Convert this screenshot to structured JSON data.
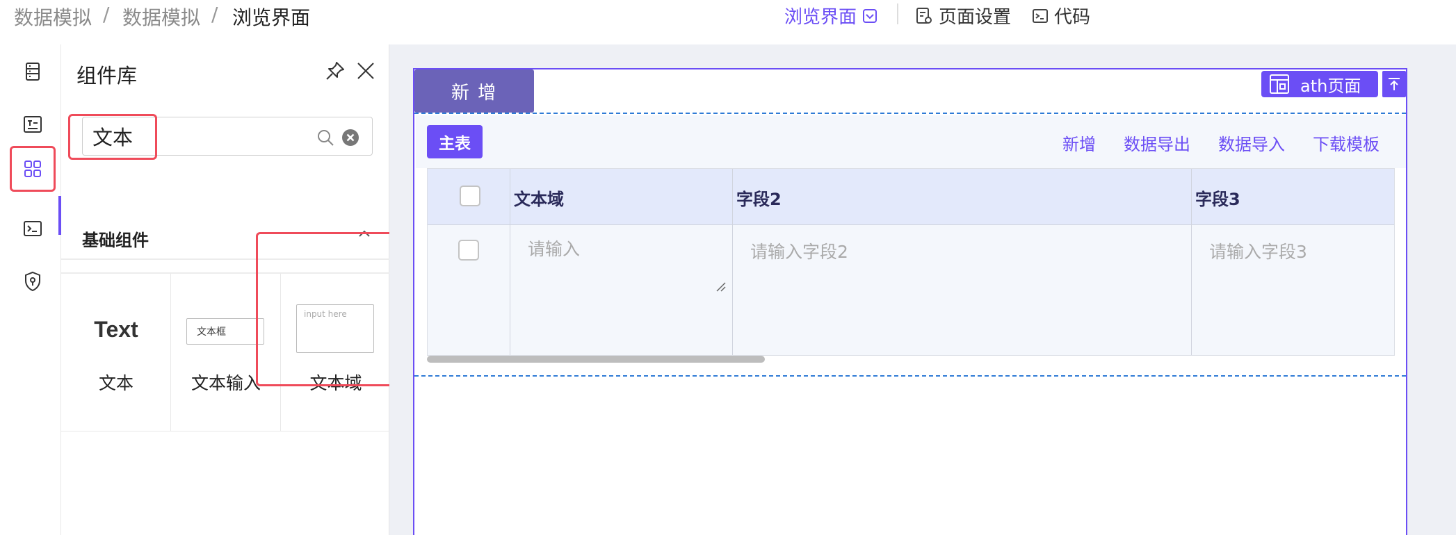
{
  "breadcrumb": {
    "items": [
      "数据模拟",
      "数据模拟",
      "浏览界面"
    ],
    "separator": "/"
  },
  "topmenu": {
    "browse": "浏览界面",
    "page_settings": "页面设置",
    "code": "代码"
  },
  "rail": {
    "icons": [
      "list-icon",
      "form-icon",
      "components-icon",
      "terminal-icon",
      "security-icon"
    ],
    "active_index": 2
  },
  "panel": {
    "title": "组件库",
    "search": {
      "value": "文本",
      "placeholder": ""
    },
    "group": {
      "title": "基础组件",
      "expanded": true
    },
    "components": [
      {
        "preview": "Text",
        "label": "文本"
      },
      {
        "preview": "文本框",
        "label": "文本输入"
      },
      {
        "preview": "input here",
        "label": "文本域"
      }
    ]
  },
  "canvas": {
    "add_button": "新 增",
    "page_tag": "ath页面",
    "tab": "主表",
    "actions": [
      "新增",
      "数据导出",
      "数据导入",
      "下载模板"
    ],
    "table": {
      "headers": [
        "文本域",
        "字段2",
        "字段3"
      ],
      "placeholders": [
        "请输入",
        "请输入字段2",
        "请输入字段3"
      ]
    }
  },
  "colors": {
    "accent": "#6b4ef5",
    "highlight": "#ef4b5a",
    "dash": "#2f7bd6"
  }
}
